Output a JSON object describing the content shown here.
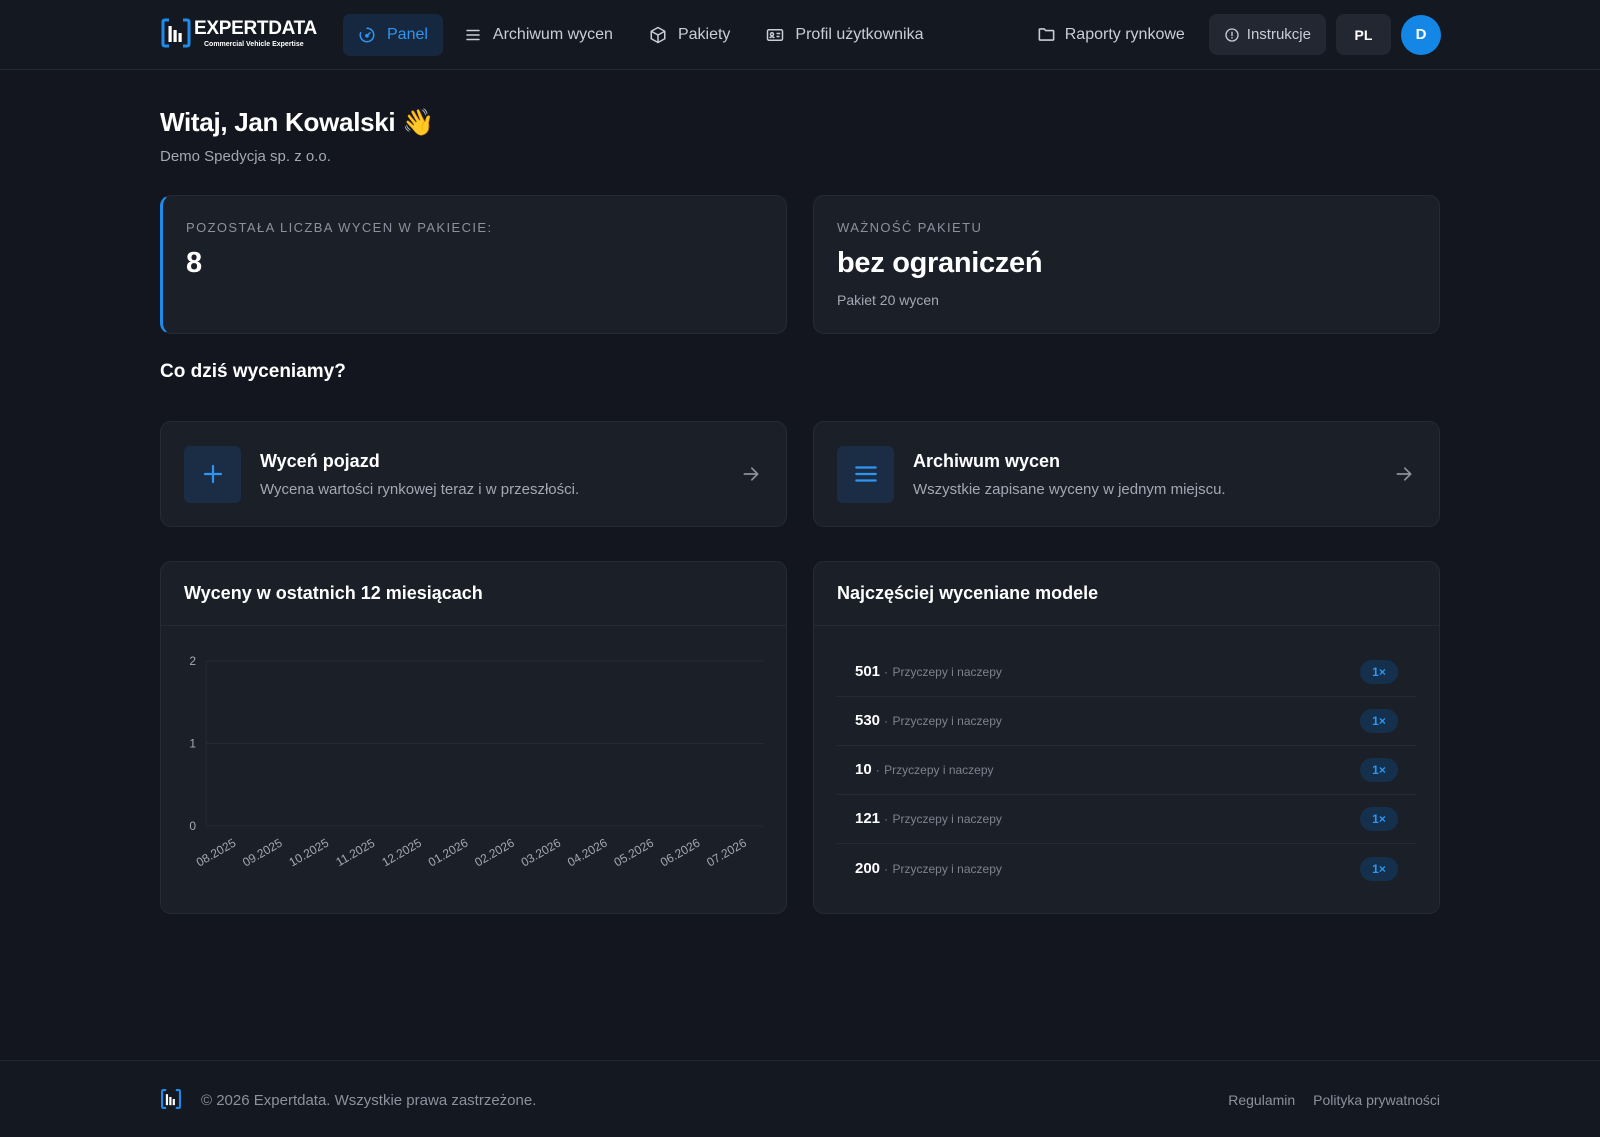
{
  "brand": {
    "name": "EXPERTDATA",
    "tagline": "Commercial Vehicle Expertise",
    "accent": "#1f8ceb"
  },
  "nav": {
    "items": [
      {
        "label": "Panel",
        "icon": "gauge-icon",
        "active": true
      },
      {
        "label": "Archiwum wycen",
        "icon": "list-icon",
        "active": false
      },
      {
        "label": "Pakiety",
        "icon": "package-icon",
        "active": false
      },
      {
        "label": "Profil użytkownika",
        "icon": "id-card-icon",
        "active": false
      }
    ],
    "reports_label": "Raporty rynkowe",
    "instructions_label": "Instrukcje",
    "language": "PL",
    "avatar_initial": "D"
  },
  "greeting": {
    "title": "Witaj, Jan Kowalski 👋",
    "company": "Demo Spedycja sp. z o.o."
  },
  "stats": {
    "remaining": {
      "label": "POZOSTAŁA LICZBA WYCEN W PAKIECIE:",
      "value": "8"
    },
    "validity": {
      "label": "WAŻNOŚĆ PAKIETU",
      "value": "bez ograniczeń",
      "note": "Pakiet 20 wycen"
    }
  },
  "section_title": "Co dziś wyceniamy?",
  "actions": {
    "valuate": {
      "title": "Wyceń pojazd",
      "desc": "Wycena wartości rynkowej teraz i w przeszłości."
    },
    "archive": {
      "title": "Archiwum wycen",
      "desc": "Wszystkie zapisane wyceny w jednym miejscu."
    }
  },
  "chart_panel": {
    "title": "Wyceny w ostatnich 12 miesiącach"
  },
  "chart_data": {
    "type": "bar",
    "categories": [
      "08.2025",
      "09.2025",
      "10.2025",
      "11.2025",
      "12.2025",
      "01.2026",
      "02.2026",
      "03.2026",
      "04.2026",
      "05.2026",
      "06.2026",
      "07.2026"
    ],
    "values": [
      0,
      0,
      0,
      0,
      0,
      0,
      0,
      0,
      0,
      0,
      0,
      0
    ],
    "yticks": [
      "0",
      "1",
      "2"
    ],
    "ylim": [
      0,
      2
    ],
    "grid": true
  },
  "models_panel": {
    "title": "Najczęściej wyceniane modele",
    "items": [
      {
        "name": "501",
        "sep": "·",
        "category": "Przyczepy i naczepy",
        "count": "1×"
      },
      {
        "name": "530",
        "sep": "·",
        "category": "Przyczepy i naczepy",
        "count": "1×"
      },
      {
        "name": "10",
        "sep": "·",
        "category": "Przyczepy i naczepy",
        "count": "1×"
      },
      {
        "name": "121",
        "sep": "·",
        "category": "Przyczepy i naczepy",
        "count": "1×"
      },
      {
        "name": "200",
        "sep": "·",
        "category": "Przyczepy i naczepy",
        "count": "1×"
      }
    ]
  },
  "footer": {
    "copyright": "© 2026 Expertdata. Wszystkie prawa zastrzeżone.",
    "links": [
      "Regulamin",
      "Polityka prywatności"
    ]
  }
}
